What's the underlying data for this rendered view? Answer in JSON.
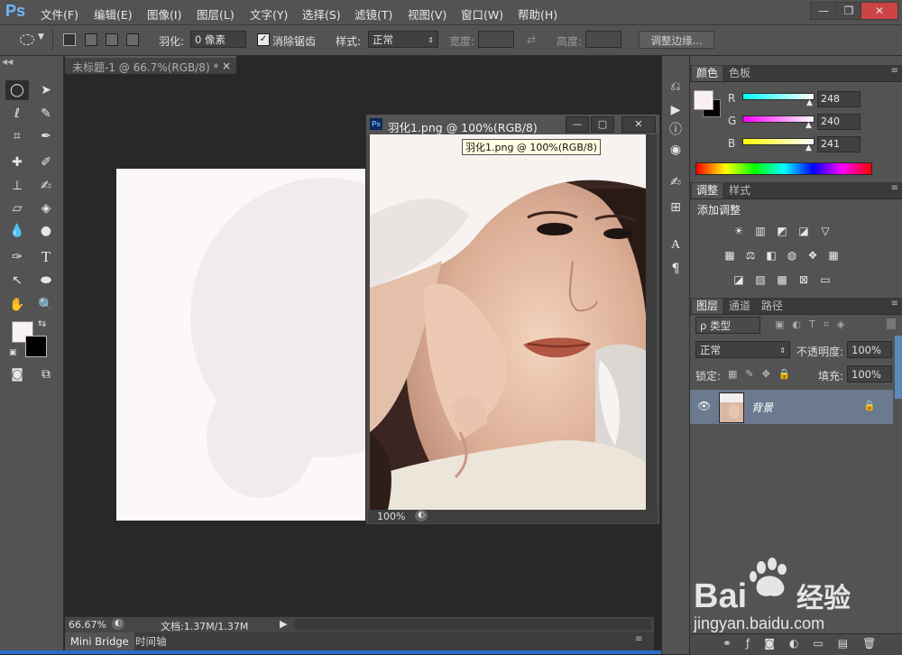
{
  "app": {
    "logo": "Ps"
  },
  "menu": [
    "文件(F)",
    "编辑(E)",
    "图像(I)",
    "图层(L)",
    "文字(Y)",
    "选择(S)",
    "滤镜(T)",
    "视图(V)",
    "窗口(W)",
    "帮助(H)"
  ],
  "window_controls": {
    "minimize": "—",
    "restore": "❐",
    "close": "✕"
  },
  "options": {
    "feather_label": "羽化:",
    "feather_value": "0 像素",
    "antialias_label": "消除锯齿",
    "antialias_checked": true,
    "style_label": "样式:",
    "style_value": "正常",
    "width_label": "宽度:",
    "height_label": "高度:",
    "refine_edge_button": "调整边缘..."
  },
  "document_tab": {
    "title": "未标题-1 @ 66.7%(RGB/8) *",
    "close": "×"
  },
  "floating_window": {
    "title": "羽化1.png @ 100%(RGB/8)",
    "tooltip": "羽化1.png @ 100%(RGB/8)",
    "zoom": "100%",
    "ps_badge": "Ps"
  },
  "status": {
    "zoom": "66.67%",
    "doc_info": "文档:1.37M/1.37M"
  },
  "bottom_tabs": [
    "Mini Bridge",
    "时间轴"
  ],
  "color_panel": {
    "tabs": [
      "颜色",
      "色板"
    ],
    "channels": [
      {
        "label": "R",
        "value": "248",
        "gradient": [
          "#00ffff",
          "#ffffff"
        ]
      },
      {
        "label": "G",
        "value": "240",
        "gradient": [
          "#ff00ff",
          "#ffffff"
        ]
      },
      {
        "label": "B",
        "value": "241",
        "gradient": [
          "#ffff00",
          "#ffffff"
        ]
      }
    ],
    "foreground": "#f8f0f1",
    "background": "#000000"
  },
  "adjust_panel": {
    "tabs": [
      "调整",
      "样式"
    ],
    "heading": "添加调整"
  },
  "layers_panel": {
    "tabs": [
      "图层",
      "通道",
      "路径"
    ],
    "filter_label": "ρ 类型",
    "blend_mode": "正常",
    "opacity_label": "不透明度:",
    "opacity_value": "100%",
    "lock_label": "锁定:",
    "fill_label": "填充:",
    "fill_value": "100%",
    "layers": [
      {
        "name": "背景",
        "visible": true,
        "locked": true
      }
    ]
  },
  "watermark": {
    "brand_left": "Bai",
    "brand_right": "经验",
    "url": "jingyan.baidu.com"
  }
}
